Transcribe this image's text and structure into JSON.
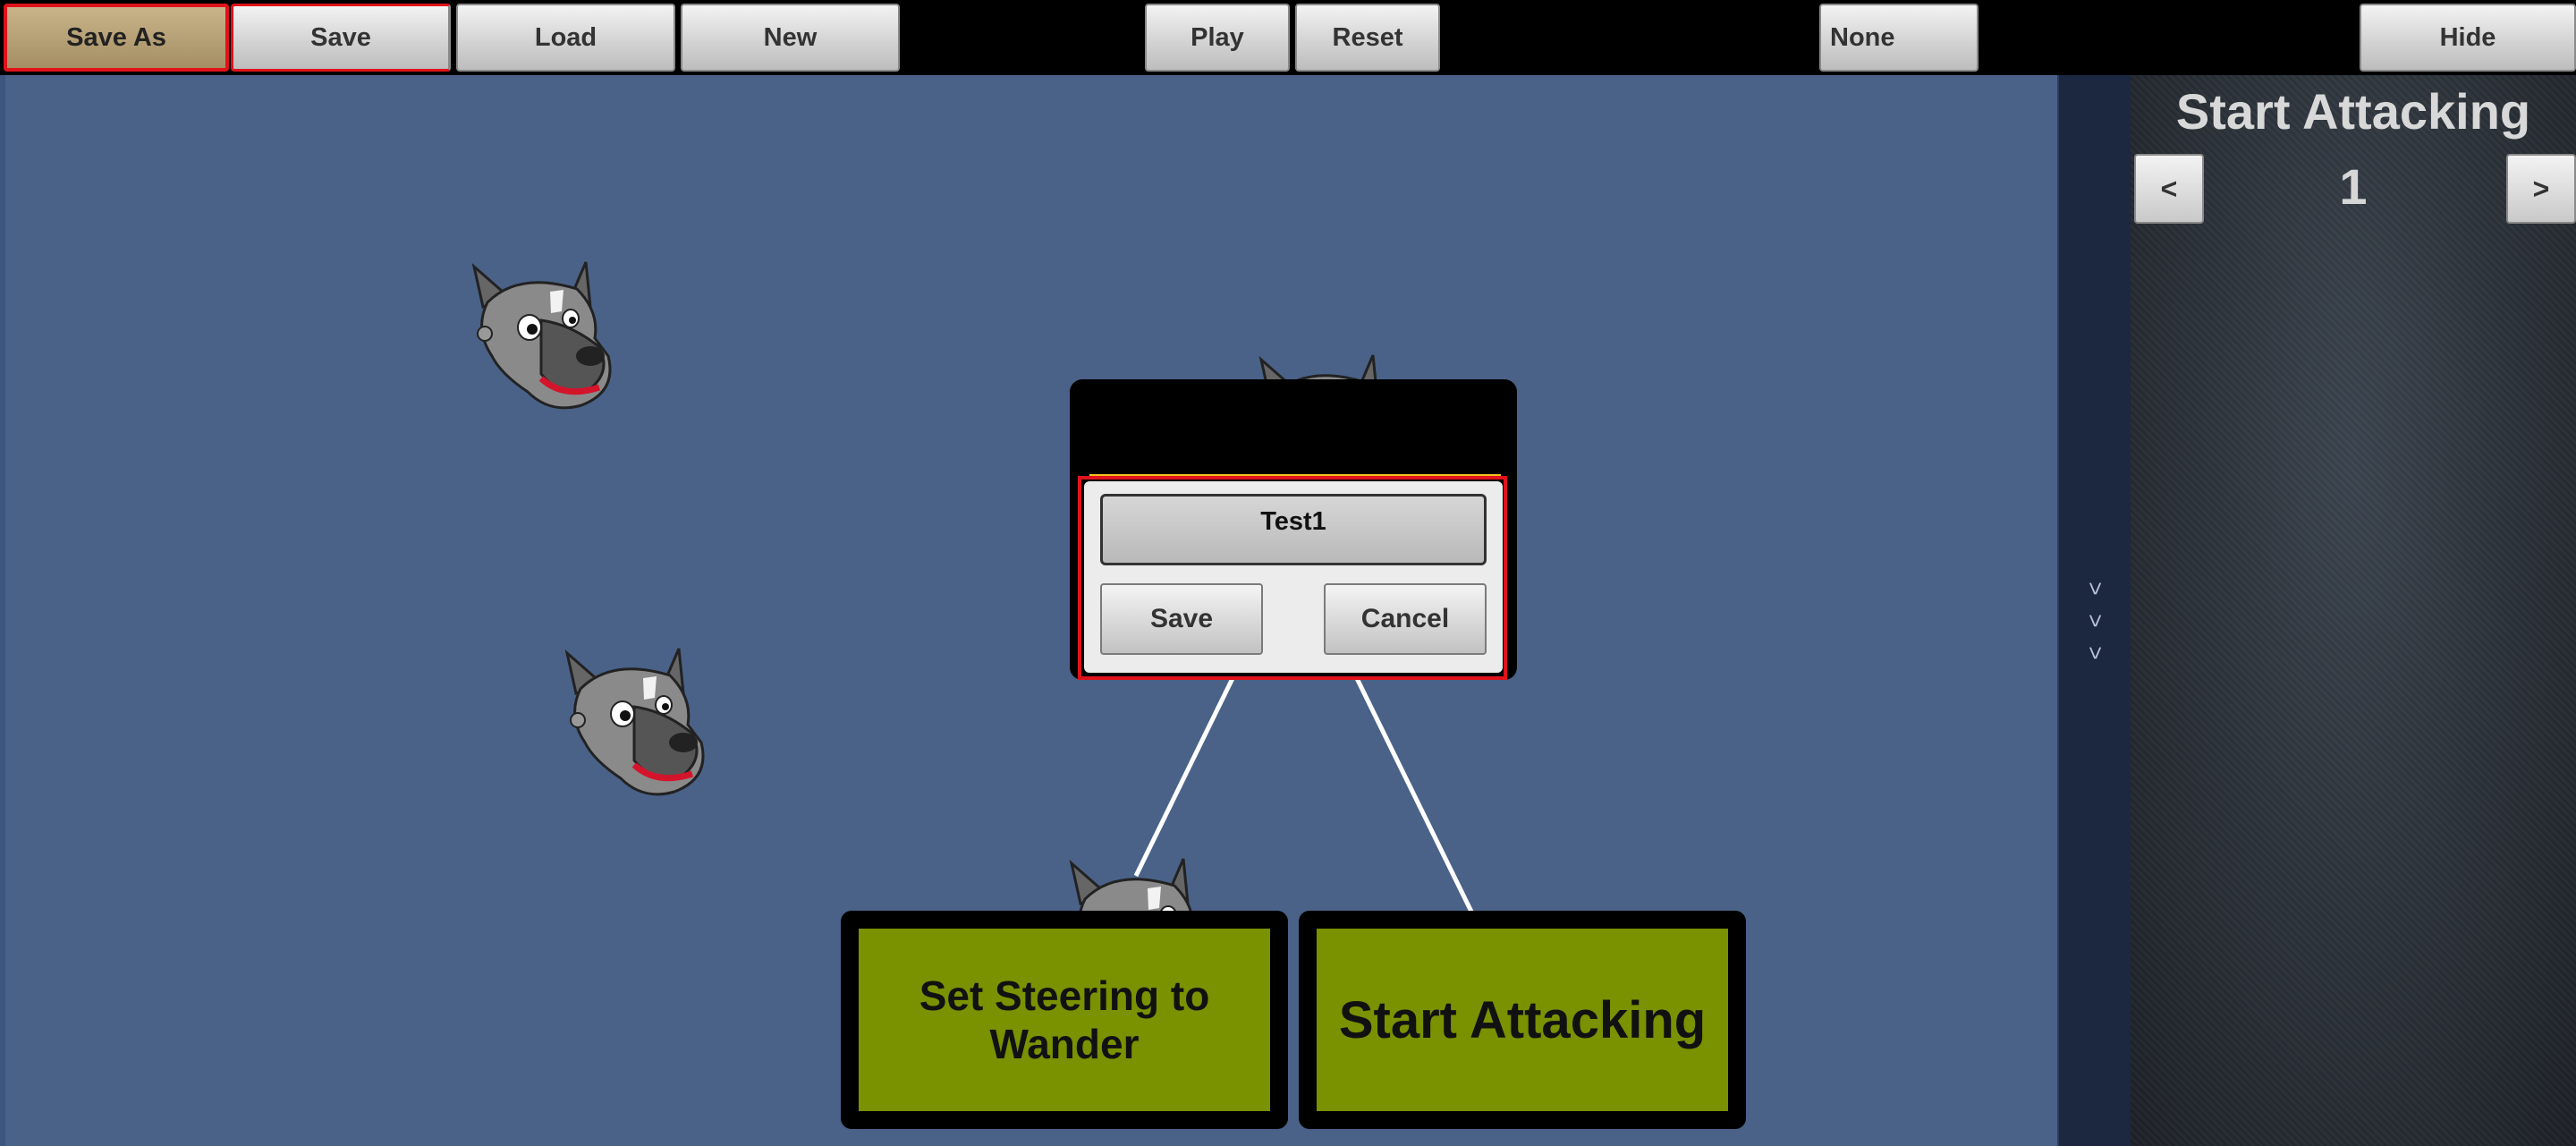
{
  "toolbar": {
    "save_as_label": "Save As",
    "save_label": "Save",
    "load_label": "Load",
    "new_label": "New",
    "play_label": "Play",
    "reset_label": "Reset",
    "none_label": "None",
    "hide_label": "Hide"
  },
  "collapse_strip": {
    "arrows": ">>>"
  },
  "side_panel": {
    "title": "Start Attacking",
    "prev_label": "<",
    "next_label": ">",
    "step_number": "1"
  },
  "save_dialog": {
    "filename_value": "Test1",
    "save_label": "Save",
    "cancel_label": "Cancel"
  },
  "nodes": {
    "left_label": "Set Steering to Wander",
    "right_label": "Start Attacking"
  },
  "colors": {
    "canvas_bg": "#4a6288",
    "node_fill": "#7a9100",
    "selection_outline": "#e0121a",
    "active_button": "#b8a073"
  },
  "icons": [
    "wolf-head-icon"
  ]
}
